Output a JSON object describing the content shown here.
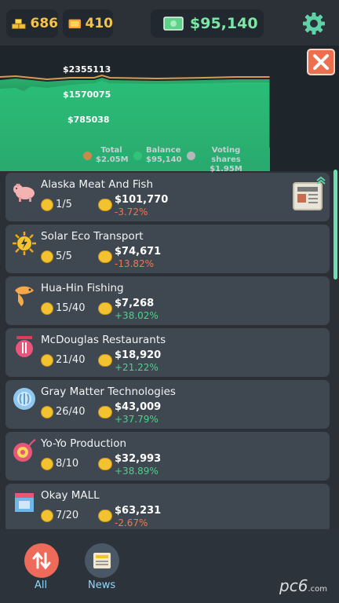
{
  "topbar": {
    "gold_count": "686",
    "gems_count": "410",
    "cash": "$95,140"
  },
  "chart": {
    "y_labels": [
      "$2355113",
      "$1570075",
      "$785038"
    ],
    "legend": [
      {
        "name": "Total",
        "value": "$2.05M",
        "color": "#c88a4a"
      },
      {
        "name": "Balance",
        "value": "$95,140",
        "color": "#2fc47a"
      },
      {
        "name": "Voting shares",
        "value": "$1.95M",
        "color": "#b4b8bb"
      }
    ]
  },
  "companies": [
    {
      "name": "Alaska Meat And Fish",
      "shares": "1/5",
      "value": "$101,770",
      "change": "-3.72%",
      "dir": "neg",
      "icon": "pig-icon"
    },
    {
      "name": "Solar Eco Transport",
      "shares": "5/5",
      "value": "$74,671",
      "change": "-13.82%",
      "dir": "neg",
      "icon": "sun-icon"
    },
    {
      "name": "Hua-Hin Fishing",
      "shares": "15/40",
      "value": "$7,268",
      "change": "+38.02%",
      "dir": "pos",
      "icon": "fish-icon"
    },
    {
      "name": "McDouglas Restaurants",
      "shares": "21/40",
      "value": "$18,920",
      "change": "+21.22%",
      "dir": "pos",
      "icon": "restaurant-icon"
    },
    {
      "name": "Gray Matter Technologies",
      "shares": "26/40",
      "value": "$43,009",
      "change": "+37.79%",
      "dir": "pos",
      "icon": "brain-gear-icon"
    },
    {
      "name": "Yo-Yo Production",
      "shares": "8/10",
      "value": "$32,993",
      "change": "+38.89%",
      "dir": "pos",
      "icon": "yoyo-icon"
    },
    {
      "name": "Okay MALL",
      "shares": "7/20",
      "value": "$63,231",
      "change": "-2.67%",
      "dir": "neg",
      "icon": "mall-icon"
    }
  ],
  "nav": {
    "all_label": "All",
    "news_label": "News"
  },
  "watermark": {
    "brand": "pc6",
    "sub": ".com"
  },
  "colors": {
    "accent_green": "#2fc47a",
    "negative": "#f07754",
    "positive": "#4fd08c",
    "close": "#ee6f4e"
  }
}
